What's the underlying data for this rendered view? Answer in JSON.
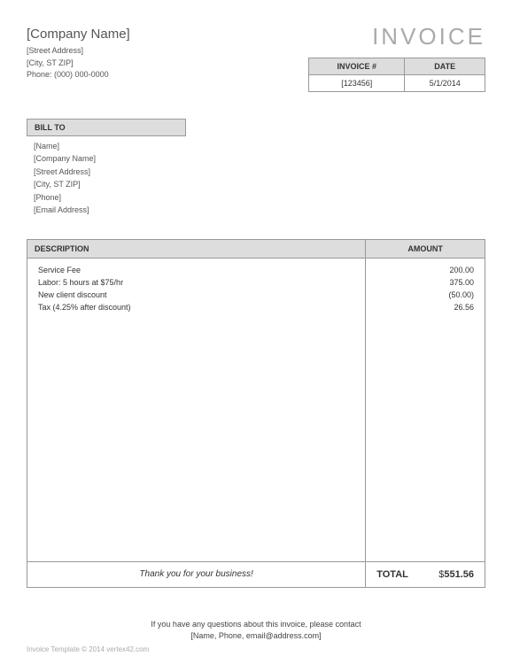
{
  "company": {
    "name": "[Company Name]",
    "street": "[Street Address]",
    "city": "[City, ST  ZIP]",
    "phone_label": "Phone:",
    "phone": "(000) 000-0000"
  },
  "title": "INVOICE",
  "meta": {
    "invoice_header": "INVOICE #",
    "date_header": "DATE",
    "invoice_number": "[123456]",
    "date": "5/1/2014"
  },
  "billto": {
    "header": "BILL TO",
    "name": "[Name]",
    "company": "[Company Name]",
    "street": "[Street Address]",
    "city": "[City, ST  ZIP]",
    "phone": "[Phone]",
    "email": "[Email Address]"
  },
  "columns": {
    "description": "DESCRIPTION",
    "amount": "AMOUNT"
  },
  "items": [
    {
      "desc": "Service Fee",
      "amount": "200.00"
    },
    {
      "desc": "Labor: 5 hours at $75/hr",
      "amount": "375.00"
    },
    {
      "desc": "New client discount",
      "amount": "(50.00)"
    },
    {
      "desc": "Tax (4.25% after discount)",
      "amount": "26.56"
    }
  ],
  "thanks": "Thank you for your business!",
  "total_label": "TOTAL",
  "currency": "$",
  "total": "551.56",
  "footnote_line1": "If you have any questions about this invoice, please contact",
  "footnote_line2": "[Name, Phone, email@address.com]",
  "copyright": "Invoice Template © 2014 vertex42.com"
}
